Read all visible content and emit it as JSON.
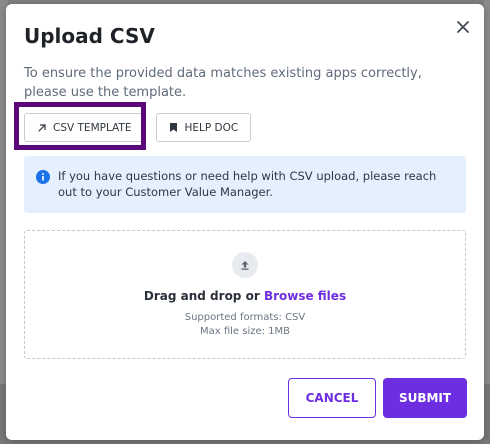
{
  "modal": {
    "title": "Upload CSV",
    "description": "To ensure the provided data matches existing apps correctly, please use the template.",
    "buttons": {
      "csv_template": "CSV TEMPLATE",
      "help_doc": "HELP DOC"
    },
    "info": {
      "text": "If you have questions or need help with CSV upload, please reach out to your Customer Value Manager."
    },
    "dropzone": {
      "drag_text": "Drag and drop or",
      "browse_link": "Browse files",
      "formats": "Supported formats: CSV",
      "max_size": "Max file size: 1MB"
    },
    "actions": {
      "cancel": "CANCEL",
      "submit": "SUBMIT"
    }
  },
  "colors": {
    "accent": "#6c2ee0",
    "highlight": "#5a087a",
    "info_bg": "#e4f0fd",
    "info_icon": "#1a73e8"
  },
  "icons": {
    "close": "close-icon",
    "csv_template": "arrow-up-right-icon",
    "help_doc": "bookmark-icon",
    "info": "info-icon",
    "upload": "upload-icon"
  }
}
